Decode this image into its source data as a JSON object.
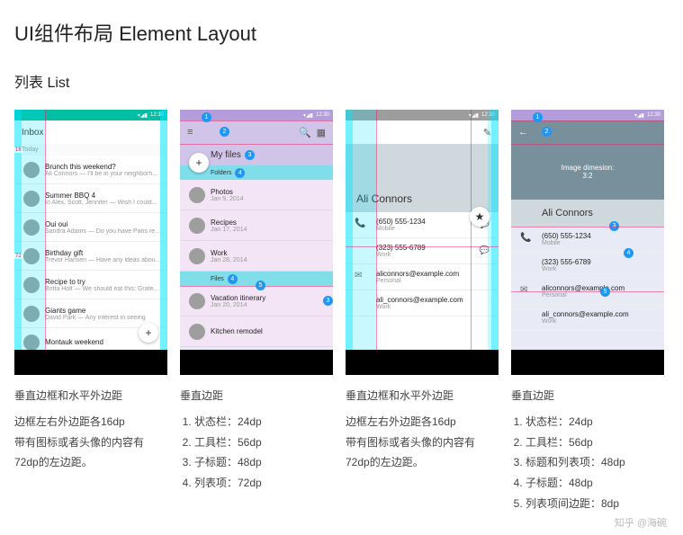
{
  "page_title": "UI组件布局 Element Layout",
  "section_title": "列表 List",
  "status_time": "12:30",
  "p1": {
    "app_title": "Inbox",
    "today": "Today",
    "items": [
      {
        "title": "Brunch this weekend?",
        "sub": "Ali Connors — I'll be in your neighborhood ..."
      },
      {
        "title": "Summer BBQ  4",
        "sub": "to Alex, Scott, Jennifer — Wish I could..."
      },
      {
        "title": "Oui oui",
        "sub": "Sandra Adams — Do you have Paris reco..."
      },
      {
        "title": "Birthday gift",
        "sub": "Trevor Hansen — Have any ideas about..."
      },
      {
        "title": "Recipe to try",
        "sub": "Britta Holt — We should eat this: Grated ..."
      },
      {
        "title": "Giants game",
        "sub": "David Park — Any interest in seeing"
      },
      {
        "title": "Montauk weekend",
        "sub": ""
      }
    ],
    "fab": "+",
    "caption_title": "垂直边框和水平外边距",
    "caption_l1": "边框左右外边距各16dp",
    "caption_l2": "带有图标或者头像的内容有 72dp的左边距。"
  },
  "p2": {
    "header": "My files",
    "sub1": "Folders",
    "sub2": "Files",
    "badges": [
      "1",
      "2",
      "3",
      "4",
      "5"
    ],
    "items1": [
      {
        "title": "Photos",
        "sub": "Jan 9, 2014"
      },
      {
        "title": "Recipes",
        "sub": "Jan 17, 2014"
      },
      {
        "title": "Work",
        "sub": "Jan 28, 2014"
      }
    ],
    "items2": [
      {
        "title": "Vacation itinerary",
        "sub": "Jan 20, 2014"
      },
      {
        "title": "Kitchen remodel",
        "sub": ""
      }
    ],
    "fab": "+",
    "caption_title": "垂直边距",
    "specs": [
      "状态栏：24dp",
      "工具栏：56dp",
      "子标题：48dp",
      "列表项：72dp"
    ]
  },
  "p3": {
    "hero_name": "Ali Connors",
    "contacts": [
      {
        "ico": "📞",
        "v": "(650) 555-1234",
        "l": "Mobile",
        "act": "💬"
      },
      {
        "ico": "",
        "v": "(323) 555-6789",
        "l": "Work",
        "act": "💬"
      },
      {
        "ico": "✉",
        "v": "aliconnors@example.com",
        "l": "Personal",
        "act": ""
      },
      {
        "ico": "",
        "v": "ali_connors@example.com",
        "l": "Work",
        "act": ""
      }
    ],
    "fab": "★",
    "edit": "✎",
    "caption_title": "垂直边框和水平外边距",
    "caption_l1": "边框左右外边距各16dp",
    "caption_l2": "带有图标或者头像的内容有 72dp的左边距。"
  },
  "p4": {
    "back": "←",
    "img_dim": "Image dimesion:\n3:2",
    "hero_name": "Ali Connors",
    "badges": [
      "1",
      "2",
      "3",
      "4",
      "5"
    ],
    "contacts": [
      {
        "ico": "📞",
        "v": "(650) 555-1234",
        "l": "Mobile"
      },
      {
        "ico": "",
        "v": "(323) 555-6789",
        "l": "Work"
      },
      {
        "ico": "✉",
        "v": "aliconnors@example.com",
        "l": "Personal"
      },
      {
        "ico": "",
        "v": "ali_connors@example.com",
        "l": "Work"
      }
    ],
    "caption_title": "垂直边距",
    "specs": [
      "状态栏：24dp",
      "工具栏：56dp",
      "标题和列表项：48dp",
      "子标题：48dp",
      "列表项间边距：8dp"
    ]
  },
  "watermark": "知乎 @海碗"
}
